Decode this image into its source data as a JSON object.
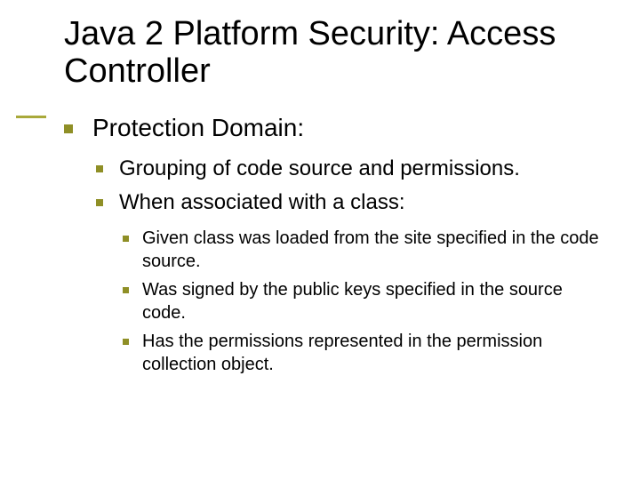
{
  "title": "Java 2 Platform Security: Access Controller",
  "bullets": {
    "lvl1": {
      "item1": "Protection Domain:"
    },
    "lvl2": {
      "item1": "Grouping of code source and permissions.",
      "item2": "When associated with a class:"
    },
    "lvl3": {
      "item1": "Given class was loaded from the site specified in the code source.",
      "item2": "Was signed by the public keys specified in the source code.",
      "item3": "Has the permissions represented in the permission collection object."
    }
  }
}
